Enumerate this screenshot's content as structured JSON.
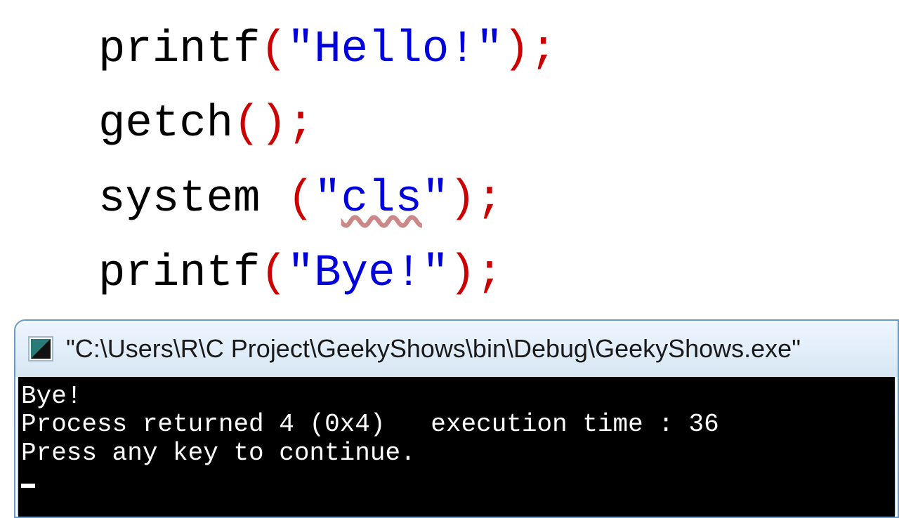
{
  "code": {
    "line1": {
      "func": "printf",
      "open": "(",
      "str": "\"Hello!\"",
      "close": ")",
      "semi": ";"
    },
    "line2": {
      "func": "getch",
      "open": "(",
      "close": ")",
      "semi": ";"
    },
    "line3": {
      "func": "system ",
      "open": "(",
      "q1": "\"",
      "cls": "cls",
      "q2": "\"",
      "close": ")",
      "semi": ";"
    },
    "line4": {
      "func": "printf",
      "open": "(",
      "str": "\"Bye!\"",
      "close": ")",
      "semi": ";"
    }
  },
  "console": {
    "title": "\"C:\\Users\\R\\C Project\\GeekyShows\\bin\\Debug\\GeekyShows.exe\"",
    "line1": "Bye!",
    "line2": "Process returned 4 (0x4)   execution time : 36",
    "line3": "Press any key to continue."
  }
}
